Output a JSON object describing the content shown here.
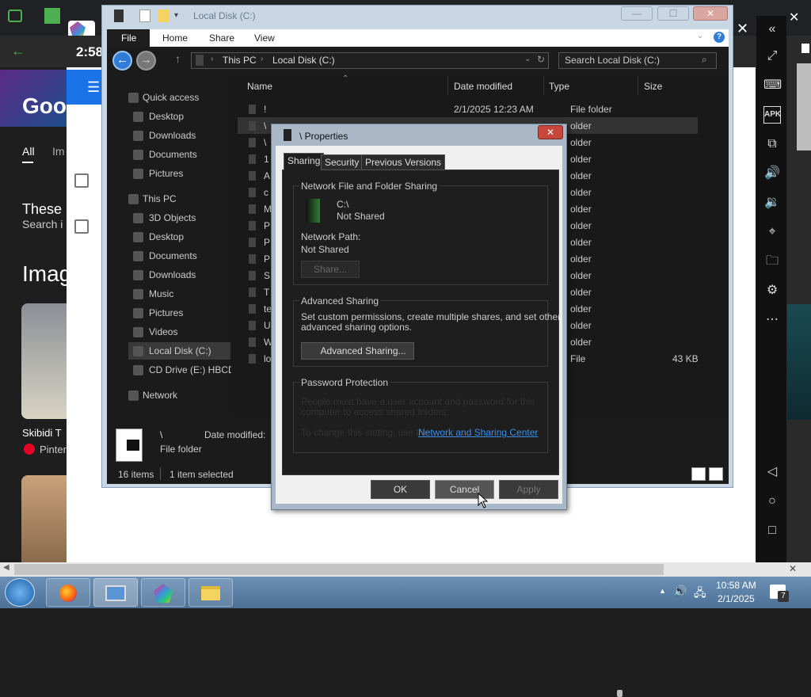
{
  "browser": {
    "time": "2:58",
    "all_tab": "All",
    "im_tab": "Im",
    "these": "These",
    "search_i": "Search i",
    "imag": "Imag",
    "skibidi": "Skibidi T",
    "pinterest": "Pinter"
  },
  "ribbon": {
    "file": "File",
    "home": "Home",
    "share": "Share",
    "view": "View"
  },
  "address": {
    "this_pc": "This PC",
    "local_disk": "Local Disk (C:)",
    "search_placeholder": "Search Local Disk (C:)"
  },
  "nav": [
    {
      "label": "Quick access",
      "indent": 0
    },
    {
      "label": "Desktop",
      "indent": 1
    },
    {
      "label": "Downloads",
      "indent": 1
    },
    {
      "label": "Documents",
      "indent": 1
    },
    {
      "label": "Pictures",
      "indent": 1
    },
    {
      "label": "This PC",
      "indent": 0
    },
    {
      "label": "3D Objects",
      "indent": 1
    },
    {
      "label": "Desktop",
      "indent": 1
    },
    {
      "label": "Documents",
      "indent": 1
    },
    {
      "label": "Downloads",
      "indent": 1
    },
    {
      "label": "Music",
      "indent": 1
    },
    {
      "label": "Pictures",
      "indent": 1
    },
    {
      "label": "Videos",
      "indent": 1
    },
    {
      "label": "Local Disk (C:)",
      "indent": 1,
      "selected": true
    },
    {
      "label": "CD Drive (E:) HBCD_",
      "indent": 1
    },
    {
      "label": "Network",
      "indent": 0
    }
  ],
  "columns": {
    "name": "Name",
    "date": "Date modified",
    "type": "Type",
    "size": "Size"
  },
  "files": [
    {
      "name": "!",
      "date": "2/1/2025 12:23 AM",
      "type": "File folder",
      "size": ""
    },
    {
      "name": "\\",
      "date": "",
      "type": "older",
      "size": ""
    },
    {
      "name": "\\",
      "date": "",
      "type": "older",
      "size": ""
    },
    {
      "name": "1",
      "date": "",
      "type": "older",
      "size": ""
    },
    {
      "name": "A",
      "date": "",
      "type": "older",
      "size": ""
    },
    {
      "name": "c",
      "date": "",
      "type": "older",
      "size": ""
    },
    {
      "name": "M",
      "date": "",
      "type": "older",
      "size": ""
    },
    {
      "name": "P",
      "date": "",
      "type": "older",
      "size": ""
    },
    {
      "name": "P",
      "date": "",
      "type": "older",
      "size": ""
    },
    {
      "name": "P",
      "date": "",
      "type": "older",
      "size": ""
    },
    {
      "name": "S",
      "date": "",
      "type": "older",
      "size": ""
    },
    {
      "name": "T",
      "date": "",
      "type": "older",
      "size": ""
    },
    {
      "name": "te",
      "date": "",
      "type": "older",
      "size": ""
    },
    {
      "name": "U",
      "date": "",
      "type": "older",
      "size": ""
    },
    {
      "name": "W",
      "date": "",
      "type": "older",
      "size": ""
    },
    {
      "name": "lo",
      "date": "",
      "type": "File",
      "size": "43 KB"
    }
  ],
  "details": {
    "name": "\\",
    "type": "File folder",
    "date_label": "Date modified:"
  },
  "status": {
    "count": "16 items",
    "selected": "1 item selected"
  },
  "dialog": {
    "title": "\\ Properties",
    "tabs": [
      "Sharing",
      "Security",
      "Previous Versions"
    ],
    "network_group": "Network File and Folder Sharing",
    "drive": "C:\\",
    "share_state": "Not Shared",
    "network_path_label": "Network Path:",
    "network_path_value": "Not Shared",
    "share_button": "Share...",
    "advanced_group": "Advanced Sharing",
    "advanced_desc_1": "Set custom permissions, create multiple shares, and set other",
    "advanced_desc_2": "advanced sharing options.",
    "advanced_button": "Advanced Sharing...",
    "password_group": "Password Protection",
    "password_desc_1": "People must have a user account and password for this",
    "password_desc_2": "computer to access shared folders.",
    "password_change": "To change this setting, use the",
    "password_link": "Network and Sharing Center",
    "ok": "OK",
    "cancel": "Cancel",
    "apply": "Apply"
  },
  "clock": {
    "time": "10:58 AM",
    "date": "2/1/2025"
  },
  "notification_count": "7"
}
